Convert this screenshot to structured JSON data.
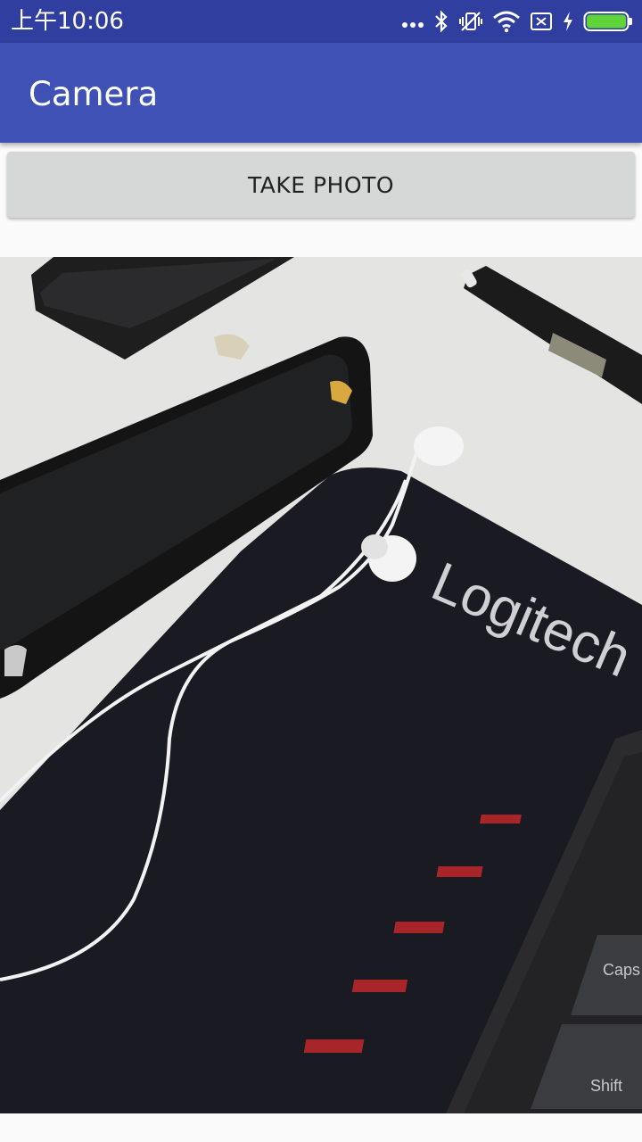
{
  "status_bar": {
    "time": "上午10:06",
    "icons": [
      "more-dots-icon",
      "bluetooth-icon",
      "vibrate-icon",
      "wifi-icon",
      "no-sim-icon",
      "charging-icon",
      "battery-icon"
    ]
  },
  "app_bar": {
    "title": "Camera"
  },
  "main": {
    "take_photo_label": "TAKE PHOTO",
    "photo": {
      "mousepad_brand": "Logitech",
      "key_labels": [
        "Caps",
        "Shift"
      ]
    }
  },
  "colors": {
    "status_bar": "#303f9f",
    "app_bar": "#3f51b5",
    "button": "#d6d7d7",
    "background": "#fafafa",
    "battery": "#5fd43a"
  }
}
